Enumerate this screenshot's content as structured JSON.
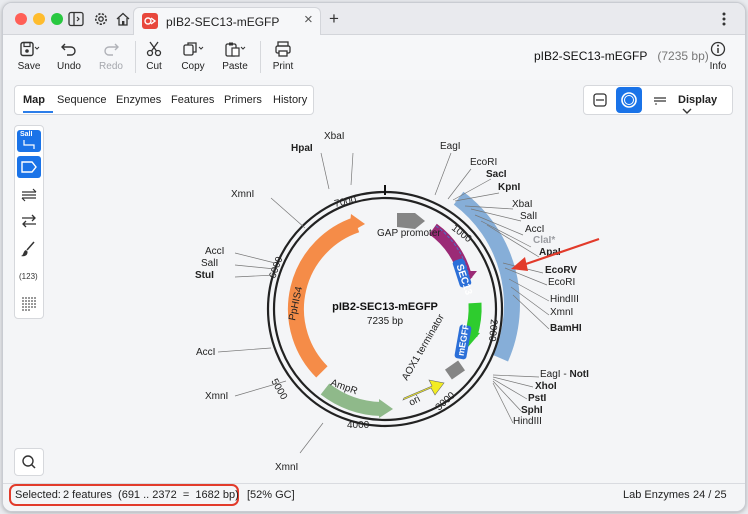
{
  "window": {
    "tab_title": "pIB2-SEC13-mEGFP",
    "new_tab_symbol": "+",
    "close_symbol": "×"
  },
  "toolbar": {
    "save": "Save",
    "undo": "Undo",
    "redo": "Redo",
    "cut": "Cut",
    "copy": "Copy",
    "paste": "Paste",
    "print": "Print",
    "info": "Info",
    "seq_name": "pIB2-SEC13-mEGFP",
    "seq_length": "(7235 bp)"
  },
  "view_tabs": [
    "Map",
    "Sequence",
    "Enzymes",
    "Features",
    "Primers",
    "History"
  ],
  "display_label": "Display",
  "sidebar": {
    "enzyme_badge": "SalI",
    "count_label": "(123)"
  },
  "map": {
    "title": "pIB2-SEC13-mEGFP",
    "length": "7235 bp",
    "ticks": [
      "1000",
      "2000",
      "3000",
      "4000",
      "5000",
      "6000",
      "7000"
    ],
    "features": {
      "gap": "GAP promoter",
      "sec13": "SEC13",
      "megfp": "mEGFP",
      "aox1": "AOX1 terminator",
      "ori": "ori",
      "ampr": "AmpR",
      "pphis4": "PpHIS4"
    },
    "sites": [
      {
        "name": "XbaI",
        "bold": false
      },
      {
        "name": "HpaI",
        "bold": true
      },
      {
        "name": "XmnI",
        "bold": false
      },
      {
        "name": "AccI",
        "bold": false
      },
      {
        "name": "SalI",
        "bold": false
      },
      {
        "name": "StuI",
        "bold": true
      },
      {
        "name": "AccI",
        "bold": false
      },
      {
        "name": "XmnI",
        "bold": false
      },
      {
        "name": "XmnI",
        "bold": false
      },
      {
        "name": "EagI",
        "bold": false
      },
      {
        "name": "EcoRI",
        "bold": false
      },
      {
        "name": "SacI",
        "bold": true
      },
      {
        "name": "KpnI",
        "bold": true
      },
      {
        "name": "XbaI",
        "bold": false
      },
      {
        "name": "SalI",
        "bold": false
      },
      {
        "name": "AccI",
        "bold": false
      },
      {
        "name": "ClaI*",
        "bold": true,
        "grey": true
      },
      {
        "name": "ApaI",
        "bold": true
      },
      {
        "name": "EcoRV",
        "bold": true
      },
      {
        "name": "EcoRI",
        "bold": false
      },
      {
        "name": "HindIII",
        "bold": false
      },
      {
        "name": "XmnI",
        "bold": false
      },
      {
        "name": "BamHI",
        "bold": true
      },
      {
        "name": "EagI - ",
        "bold": false
      },
      {
        "name": "NotI",
        "bold": true
      },
      {
        "name": "XhoI",
        "bold": true
      },
      {
        "name": "PstI",
        "bold": true
      },
      {
        "name": "SphI",
        "bold": true
      },
      {
        "name": "HindIII",
        "bold": false
      }
    ]
  },
  "status": {
    "selected_prefix": "Selected:",
    "selected_detail": "2 features  (691 .. 2372  =  1682 bp)",
    "gc": "[52% GC]",
    "enzyme_set": "Lab Enzymes",
    "enzyme_count": "24 / 25"
  },
  "colors": {
    "accent": "#1a73e8",
    "selection_arc": "#7aa6d4",
    "highlight_box": "#e23b2b",
    "annotation_arrow": "#e23b2b"
  }
}
